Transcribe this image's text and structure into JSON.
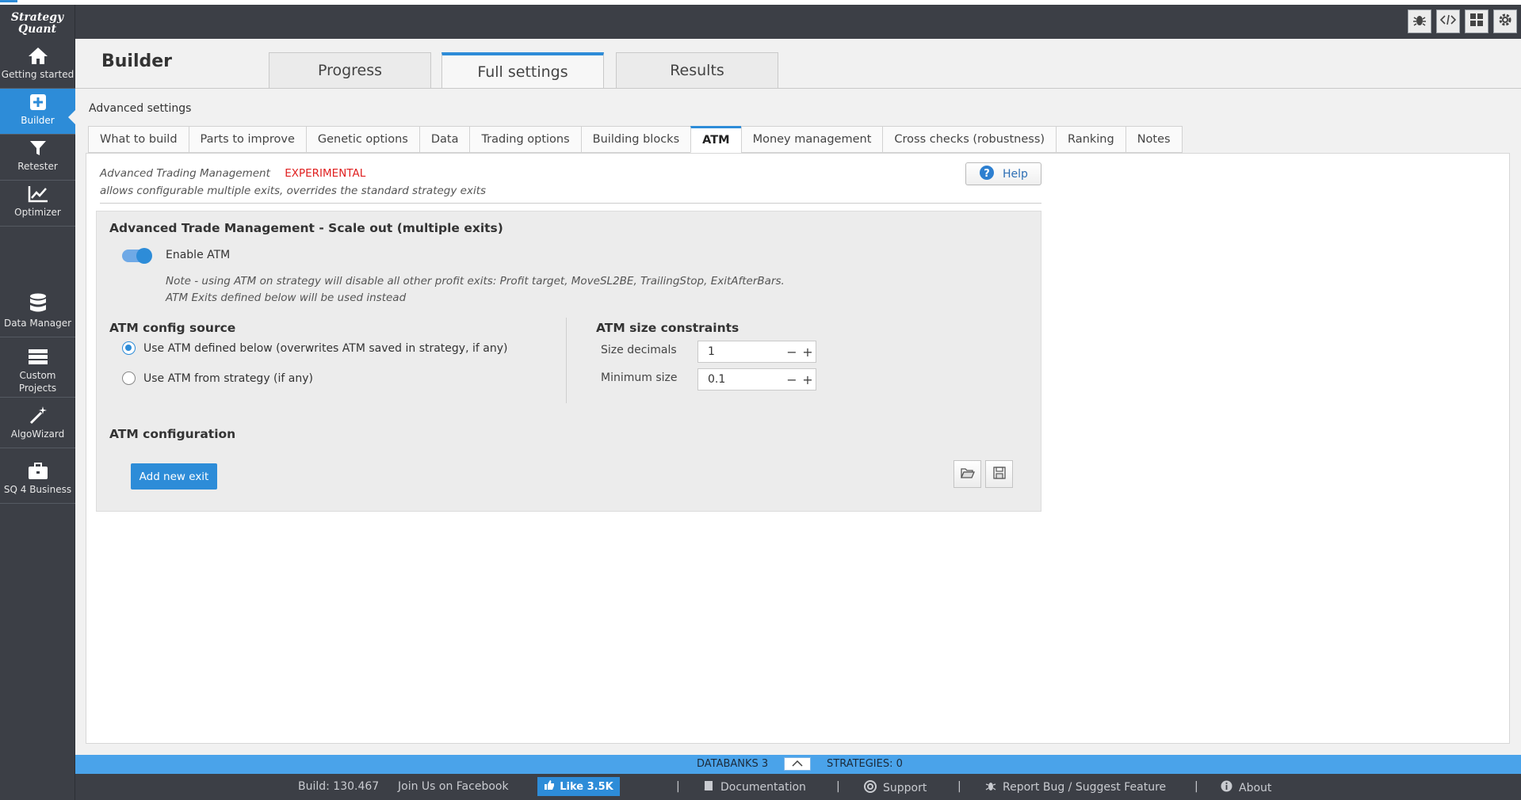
{
  "app": {
    "logo_line1": "Strategy",
    "logo_line2": "Quant"
  },
  "sidebar": {
    "items": [
      {
        "label": "Getting started",
        "icon": "home-icon"
      },
      {
        "label": "Builder",
        "icon": "plus-icon"
      },
      {
        "label": "Retester",
        "icon": "filter-icon"
      },
      {
        "label": "Optimizer",
        "icon": "chart-icon"
      },
      {
        "label": "Data Manager",
        "icon": "database-icon"
      },
      {
        "label": "Custom Projects",
        "icon": "projects-icon"
      },
      {
        "label": "AlgoWizard",
        "icon": "wand-icon"
      },
      {
        "label": "SQ 4 Business",
        "icon": "briefcase-icon"
      }
    ]
  },
  "header": {
    "title": "Builder",
    "tabs": [
      "Progress",
      "Full settings",
      "Results"
    ],
    "tools": [
      "bug-icon",
      "code-icon",
      "layout-icon",
      "gear-icon"
    ]
  },
  "advanced": {
    "label": "Advanced settings",
    "tabs": [
      "What to build",
      "Parts to improve",
      "Genetic options",
      "Data",
      "Trading options",
      "Building blocks",
      "ATM",
      "Money management",
      "Cross checks (robustness)",
      "Ranking",
      "Notes"
    ]
  },
  "atm": {
    "desc_title": "Advanced Trading Management",
    "desc_badge": "EXPERIMENTAL",
    "desc_line2": "allows configurable multiple exits, overrides the standard strategy exits",
    "help_label": "Help",
    "section_title": "Advanced Trade Management - Scale out (multiple exits)",
    "enable_label": "Enable ATM",
    "note_line1": "Note - using ATM on strategy will disable all other profit exits: Profit target, MoveSL2BE, TrailingStop, ExitAfterBars.",
    "note_line2": "ATM Exits defined below will be used instead",
    "config_source_title": "ATM config source",
    "radio_defined": "Use ATM defined below (overwrites ATM saved in strategy, if any)",
    "radio_strategy": "Use ATM from strategy (if any)",
    "size_title": "ATM size constraints",
    "size_decimals_label": "Size decimals",
    "size_decimals_value": "1",
    "min_size_label": "Minimum size",
    "min_size_value": "0.1",
    "config_title": "ATM configuration",
    "add_exit_label": "Add new exit"
  },
  "status": {
    "databanks": "DATABANKS 3",
    "strategies": "STRATEGIES: 0"
  },
  "footer": {
    "build": "Build: 130.467",
    "join": "Join Us on Facebook",
    "like": "Like 3.5K",
    "documentation": "Documentation",
    "support": "Support",
    "report": "Report Bug / Suggest Feature",
    "about": "About"
  },
  "colors": {
    "accent": "#2d8cd8",
    "experimental": "#e02020",
    "sidebar": "#3c3f46"
  }
}
